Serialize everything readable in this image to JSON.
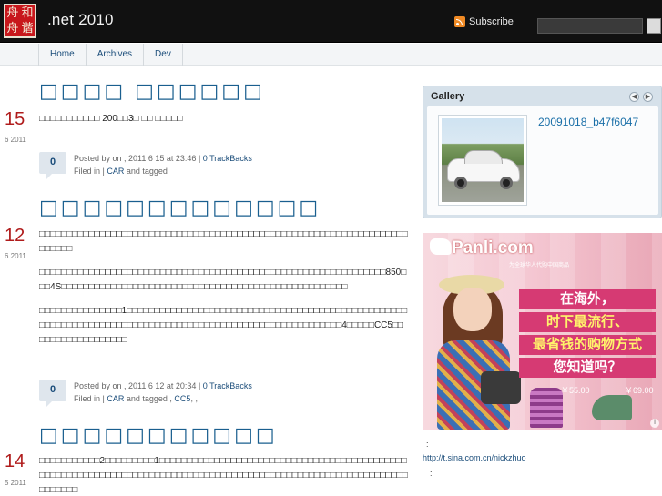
{
  "header": {
    "logo_chars": [
      "舟",
      "和",
      "舟",
      "谐"
    ],
    "site_title": ".net 2010",
    "subscribe_label": "Subscribe",
    "search_placeholder": ""
  },
  "nav": {
    "tabs": [
      "Home",
      "Archives",
      "Dev"
    ]
  },
  "posts": [
    {
      "day": "15",
      "month_year": "6 2011",
      "title": "□□□□ □□□□□□",
      "body": [
        "□□□□□□□□□□□ 200□□3□ □□ □□□□□"
      ],
      "comments": "0",
      "meta_line1": "Posted by     on     , 2011 6 15   at 23:46 |",
      "trackbacks": "0 TrackBacks",
      "filed_prefix": "Filed in     | ",
      "filed_link": "CAR",
      "filed_suffix": " and tagged"
    },
    {
      "day": "12",
      "month_year": "6 2011",
      "title": "□□□□□□□□□□□□□",
      "body": [
        "□□□□□□□□□□□□□□□□□□□□□□□□□□□□□□□□□□□□□□□□□□□□□□□□□□□□□□□□□□□□□□□□□□□□□□□□□",
        "□□□□□□□□□□□□□□□□□□□□□□□□□□□□□□□□□□□□□□□□□□□□□□□□□□□□□□□□□□□□□□□850□□□4S□□□□□□□□□□□□□□□□□□□□□□□□□□□□□□□□□□□□□□□□□□□□□□□□□□□□",
        "□□□□□□□□□□□□□□□1□□□□□□□□□□□□□□□□□□□□□□□□□□□□□□□□□□□□□□□□□□□□□□□□□□□□□□□□□□□□□□□□□□□□□□□□□□□□□□□□□□□□□□□□□□□□□□□□□□□□□□□□□□4□□□□□CC5□□□□□□□□□□□□□□□□□□"
      ],
      "comments": "0",
      "meta_line1": "Posted by     on     , 2011 6 12   at 20:34 |",
      "trackbacks": "0 TrackBacks",
      "filed_prefix": "Filed in     | ",
      "filed_link": "CAR",
      "filed_suffix": " and tagged          ,   ",
      "tag_link": "CC5",
      "tag_suffix": ",   ,"
    },
    {
      "day": "14",
      "month_year": "5 2011",
      "title": "□□□□□□□□□□□",
      "body": [
        "□□□□□□□□□□□2□□□□□□□□□1□□□□□□□□□□□□□□□□□□□□□□□□□□□□□□□□□□□□□□□□□□□□□□□□□□□□□□□□□□□□□□□□□□□□□□□□□□□□□□□□□□□□□□□□□□□□□□□□□□□□□□□□□□□□□□□□□□□□□□□"
      ]
    }
  ],
  "sidebar": {
    "gallery_title": "Gallery",
    "gallery_prev": "◀",
    "gallery_next": "▶",
    "gallery_caption": "20091018_b47f6047",
    "ad": {
      "brand": "Panli.com",
      "tagline": "为全球华人代购中国商品",
      "headline": [
        "在海外，",
        "时下最流行、",
        "最省钱的购物方式",
        "您知道吗？"
      ],
      "price1": "￥55.00",
      "price2": "￥69.00",
      "info": "i"
    },
    "colon1": ":",
    "link": "http://t.sina.com.cn/nickzhuo",
    "colon2": ":"
  }
}
